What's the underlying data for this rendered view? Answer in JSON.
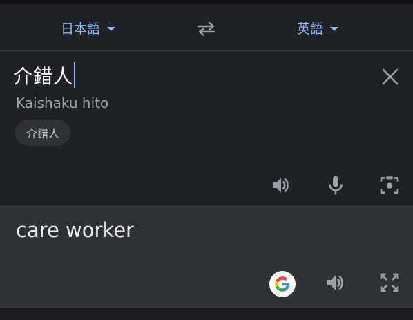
{
  "languages": {
    "source": "日本語",
    "target": "英語"
  },
  "source_panel": {
    "text": "介錯人",
    "romanization": "Kaishaku hito",
    "suggestion_chip": "介錯人"
  },
  "result_panel": {
    "text": "care worker"
  },
  "icons": {
    "source_dropdown": "chevron-down-icon",
    "target_dropdown": "chevron-down-icon",
    "swap": "swap-languages-icon",
    "clear": "close-icon",
    "speaker": "speaker-icon",
    "mic": "microphone-icon",
    "camera": "camera-icon",
    "google": "google-logo-icon",
    "expand": "fullscreen-icon"
  },
  "colors": {
    "accent": "#8ab4f8",
    "background": "#202124",
    "result_background": "#303134",
    "icon_gray": "#9aa0a6"
  }
}
